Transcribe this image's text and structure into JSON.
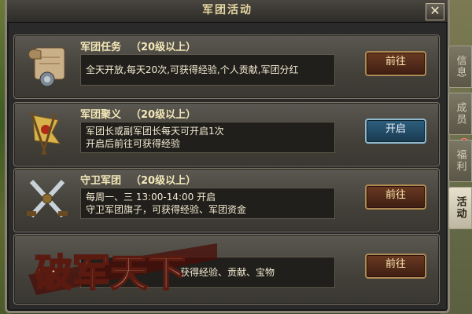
{
  "panel": {
    "title": "军团活动"
  },
  "close_label": "✕",
  "cards": [
    {
      "name": "军团任务",
      "level": "（20级以上）",
      "desc_lines": [
        "全天开放,每天20次,可获得经验,个人贡献,军团分红"
      ],
      "button": "前往",
      "icon": "scroll-icon"
    },
    {
      "name": "军团聚义",
      "level": "（20级以上）",
      "desc_lines": [
        "军团长或副军团长每天可开启1次",
        "开启后前往可获得经验"
      ],
      "button": "开启",
      "icon": "banner-icon"
    },
    {
      "name": "守卫军团",
      "level": "（20级以上）",
      "desc_lines": [
        "每周一、三 13:00-14:00 开启",
        "守卫军团旗子，可获得经验、军团资金"
      ],
      "button": "前往",
      "icon": "crossed-swords-icon"
    },
    {
      "name": "",
      "level": "",
      "desc_lines": [
        "获得经验、贡献、宝物"
      ],
      "button": "前往",
      "icon": ""
    }
  ],
  "tabs": [
    "信息",
    "成员",
    "福利",
    "活动"
  ],
  "active_tab": "活动",
  "watermark": "破军天下",
  "colors": {
    "button_primary": "#5a2e1a",
    "button_alt": "#2d5f7e",
    "gold_text": "#f3e7b8"
  }
}
